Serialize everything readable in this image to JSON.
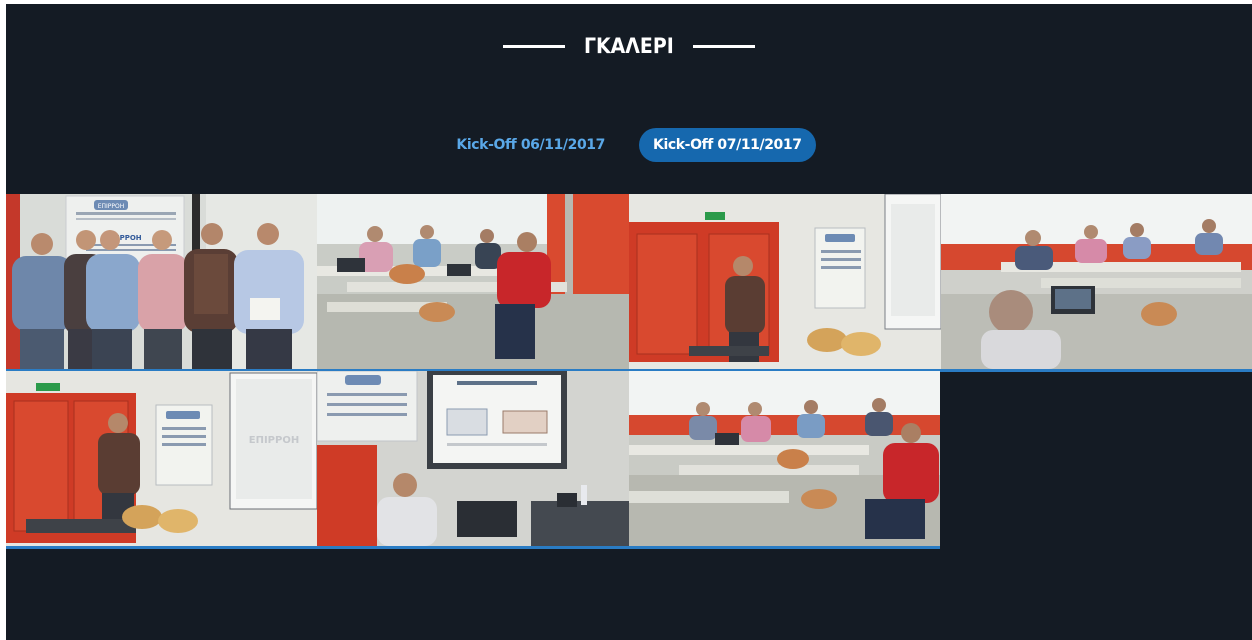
{
  "gallery": {
    "title": "ΓΚΑΛΕΡΙ",
    "tabs": [
      {
        "label": "Kick-Off 06/11/2017",
        "active": false
      },
      {
        "label": "Kick-Off 07/11/2017",
        "active": true
      }
    ],
    "banner_text": "ΕΠΙΡΡΟΗ",
    "screen_text": "ΕΠΙΡΡΟΗ",
    "colors": {
      "background": "#141b24",
      "accent": "#1668ae",
      "tab_text": "#5aa8e8",
      "divider": "#2a7cc4"
    }
  }
}
